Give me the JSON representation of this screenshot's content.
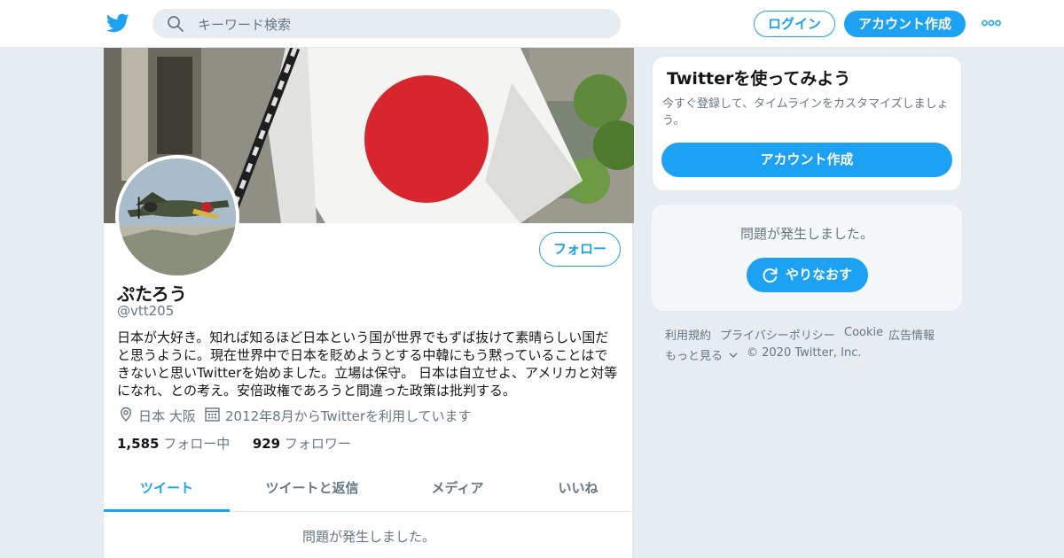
{
  "header": {
    "search_placeholder": "キーワード検索",
    "login_label": "ログイン",
    "signup_label": "アカウント作成"
  },
  "profile": {
    "follow_label": "フォロー",
    "name": "ぷたろう",
    "handle": "@vtt205",
    "bio": "日本が大好き。知れば知るほど日本という国が世界でもずば抜けて素晴らしい国だと思うように。現在世界中で日本を貶めようとする中韓にもう黙っていることはできないと思いTwitterを始めました。立場は保守。 日本は自立せよ、アメリカと対等になれ、との考え。安倍政権であろうと間違った政策は批判する。",
    "location": "日本 大阪",
    "joined": "2012年8月からTwitterを利用しています",
    "following_count": "1,585",
    "following_label": "フォロー中",
    "followers_count": "929",
    "followers_label": "フォロワー",
    "tabs": [
      "ツイート",
      "ツイートと返信",
      "メディア",
      "いいね"
    ],
    "error_text": "問題が発生しました。"
  },
  "sidebar": {
    "signup_title": "Twitterを使ってみよう",
    "signup_desc": "今すぐ登録して、タイムラインをカスタマイズしましょう。",
    "signup_button": "アカウント作成",
    "error_text": "問題が発生しました。",
    "retry_label": "やりなおす"
  },
  "footer": {
    "links": [
      "利用規約",
      "プライバシーポリシー",
      "Cookie",
      "広告情報",
      "もっと見る"
    ],
    "copyright": "© 2020 Twitter, Inc."
  },
  "colors": {
    "accent": "#1da1f2",
    "muted": "#657786",
    "background": "#e6ecf0"
  }
}
